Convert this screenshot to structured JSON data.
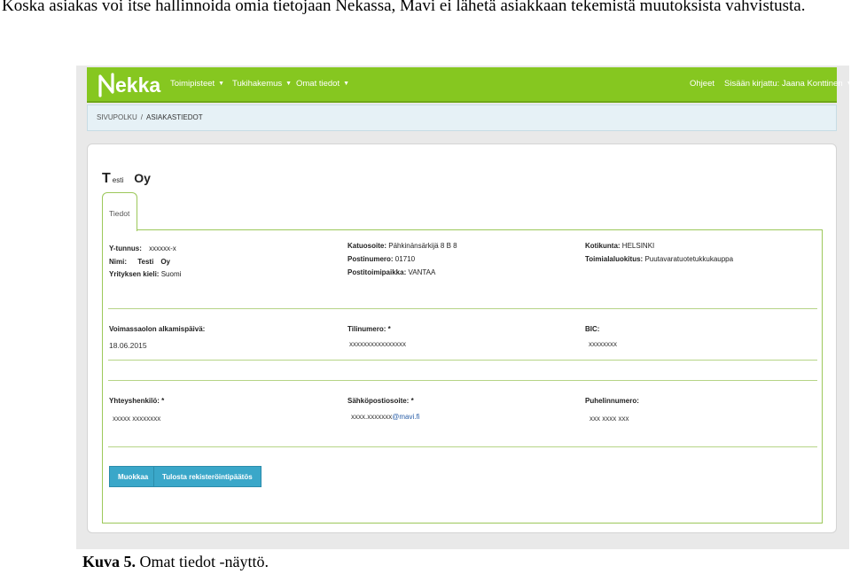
{
  "document": {
    "intro_text": "Koska asiakas voi itse hallinnoida omia tietojaan Nekassa, Mavi ei lähetä asiakkaan tekemistä muutoksista vahvistusta.",
    "caption_label": "Kuva 5.",
    "caption_text": "Omat tiedot -näyttö."
  },
  "app": {
    "logo_text": "ekka",
    "logo_icon": "nekka-n-logo",
    "colors": {
      "navbar": "#86c720",
      "button": "#3aa7c9",
      "breadcrumb_bg": "#e6f1f6"
    },
    "nav": {
      "toimipisteet": "Toimipisteet",
      "tukihakemus": "Tukihakemus",
      "omat_tiedot": "Omat tiedot",
      "ohjeet": "Ohjeet",
      "user": "Sisään kirjattu: Jaana Konttinen"
    },
    "breadcrumb": {
      "root": "Sivupolku",
      "separator": "/",
      "current": "Asiakastiedot"
    }
  },
  "customer": {
    "name_first_letter": "T",
    "name_rest": "esti",
    "name_suffix": "Oy",
    "tab_label": "Tiedot",
    "info": {
      "ytunnus_label": "Y-tunnus:",
      "ytunnus_value": "xxxxxx-x",
      "nimi_label": "Nimi:",
      "nimi_value": "Testi",
      "nimi_suffix": "Oy",
      "kieli_label": "Yrityksen kieli:",
      "kieli_value": "Suomi",
      "katuosoite_label": "Katuosoite:",
      "katuosoite_value": "Pähkinänsärkijä 8 B 8",
      "postinumero_label": "Postinumero:",
      "postinumero_value": "01710",
      "postitoimipaikka_label": "Postitoimipaikka:",
      "postitoimipaikka_value": "VANTAA",
      "kotikunta_label": "Kotikunta:",
      "kotikunta_value": "HELSINKI",
      "toimiala_label": "Toimialaluokitus:",
      "toimiala_value": "Puutavaratuotetukkukauppa"
    },
    "bank": {
      "voimassa_label": "Voimassaolon alkamispäivä:",
      "voimassa_value": "18.06.2015",
      "tilinumero_label": "Tilinumero: *",
      "tilinumero_value": "xxxxxxxxxxxxxxxx",
      "bic_label": "BIC:",
      "bic_value": "xxxxxxxx"
    },
    "contact": {
      "yhteyshenkilo_label": "Yhteyshenkilö: *",
      "yhteyshenkilo_value": "xxxxx xxxxxxxx",
      "sahkoposti_label": "Sähköpostiosoite: *",
      "sahkoposti_local": "xxxx.xxxxxxx",
      "sahkoposti_domain": "@mavi.fi",
      "puhelin_label": "Puhelinnumero:",
      "puhelin_value": "xxx xxxx xxx"
    },
    "buttons": {
      "muokkaa": "Muokkaa",
      "tulosta": "Tulosta rekisteröintipäätös"
    }
  }
}
